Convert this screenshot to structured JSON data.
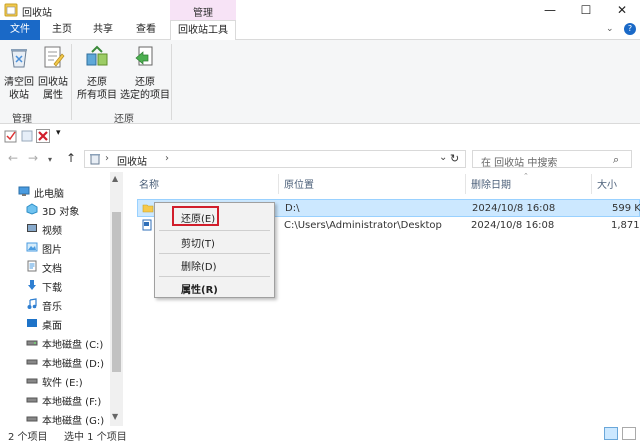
{
  "window": {
    "title": "回收站",
    "context_tab_group": "管理",
    "controls": {
      "minimize": "—",
      "maximize": "☐",
      "close": "✕"
    }
  },
  "tabs": {
    "file": "文件",
    "home": "主页",
    "share": "共享",
    "view": "查看",
    "tools": "回收站工具",
    "collapse": "⌄",
    "help": "?"
  },
  "ribbon": {
    "empty_bin": [
      "清空回",
      "收站"
    ],
    "bin_props": [
      "回收站",
      "属性"
    ],
    "restore_all": [
      "还原",
      "所有项目"
    ],
    "restore_selected": [
      "还原",
      "选定的项目"
    ],
    "group_manage": "管理",
    "group_restore": "还原"
  },
  "address": {
    "breadcrumb": "回收站",
    "search_placeholder": "在 回收站 中搜索"
  },
  "nav_pane": {
    "items": [
      {
        "label": "此电脑",
        "icon": "computer-icon"
      },
      {
        "label": "3D 对象",
        "icon": "3d-objects-icon"
      },
      {
        "label": "视频",
        "icon": "video-icon"
      },
      {
        "label": "图片",
        "icon": "pictures-icon"
      },
      {
        "label": "文档",
        "icon": "documents-icon"
      },
      {
        "label": "下载",
        "icon": "download-icon"
      },
      {
        "label": "音乐",
        "icon": "music-icon"
      },
      {
        "label": "桌面",
        "icon": "desktop-icon"
      },
      {
        "label": "本地磁盘 (C:)",
        "icon": "drive-icon"
      },
      {
        "label": "本地磁盘 (D:)",
        "icon": "drive-icon"
      },
      {
        "label": "软件 (E:)",
        "icon": "drive-icon"
      },
      {
        "label": "本地磁盘 (F:)",
        "icon": "drive-icon"
      },
      {
        "label": "本地磁盘 (G:)",
        "icon": "drive-icon"
      }
    ]
  },
  "columns": {
    "name": "名称",
    "original_location": "原位置",
    "date_deleted": "删除日期",
    "size": "大小"
  },
  "files": [
    {
      "location": "D:\\",
      "date": "2024/10/8 16:08",
      "size": "599 K"
    },
    {
      "location": "C:\\Users\\Administrator\\Desktop",
      "date": "2024/10/8 16:08",
      "size": "1,871 K"
    }
  ],
  "context_menu": {
    "restore": "还原(E)",
    "cut": "剪切(T)",
    "delete": "删除(D)",
    "properties": "属性(R)"
  },
  "status": {
    "item_count": "2 个项目",
    "selected": "选中 1 个项目"
  },
  "colors": {
    "accent": "#1a69c7",
    "tools_band": "#f7e3f6",
    "selection": "#cce8ff",
    "highlight_box": "#d11e2b"
  }
}
